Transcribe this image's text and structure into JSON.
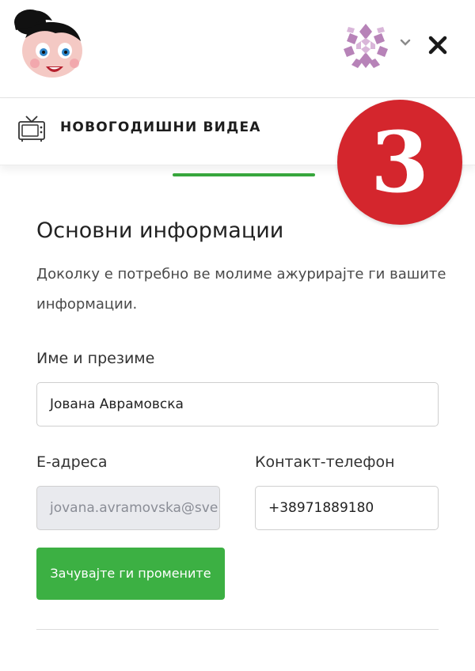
{
  "header": {
    "logo_icon": "cartoon-girl-logo-icon",
    "avatar_icon": "geometric-pattern-avatar-icon",
    "dropdown_icon": "chevron-down-icon",
    "close_icon": "close-icon"
  },
  "nav": {
    "icon": "tv-icon",
    "label": "НОВОГОДИШНИ ВИДЕА",
    "active_color": "#37a63c"
  },
  "badge": {
    "text": "3",
    "color": "#d4262d"
  },
  "section": {
    "title": "Основни информации",
    "description": "Доколку е потребно ве молиме ажурирајте ги вашите информации."
  },
  "form": {
    "name_label": "Име и презиме",
    "name_value": "Јована Аврамовска",
    "email_label": "Е-адреса",
    "email_value": "jovana.avramovska@sve",
    "phone_label": "Контакт-телефон",
    "phone_value": "+38971889180",
    "save_label": "Зачувајте ги промените",
    "save_color": "#3cb043"
  }
}
